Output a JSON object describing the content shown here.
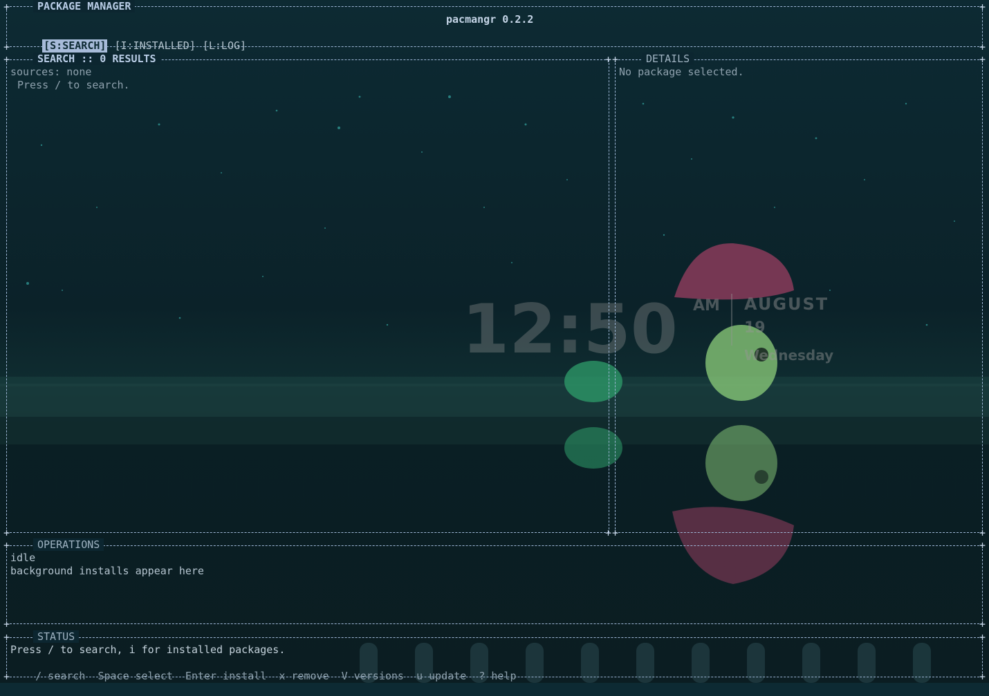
{
  "app": {
    "panel_title": "PACKAGE MANAGER",
    "name": "pacmangr 0.2.2"
  },
  "tabs": [
    {
      "label": "[S:SEARCH]",
      "active": true
    },
    {
      "label": "[I:INSTALLED]",
      "active": false
    },
    {
      "label": "[L:LOG]",
      "active": false
    }
  ],
  "search": {
    "title": "SEARCH :: 0 RESULTS",
    "sources": "sources: none",
    "hint": "Press / to search."
  },
  "details": {
    "title": "DETAILS",
    "empty": "No package selected."
  },
  "operations": {
    "title": "OPERATIONS",
    "state": "idle",
    "note": "background installs appear here"
  },
  "status": {
    "title": "STATUS",
    "message": "Press / to search, i for installed packages.",
    "keys": [
      {
        "label": "/ search"
      },
      {
        "label": "Space select"
      },
      {
        "label": "Enter install"
      },
      {
        "label": "x remove"
      },
      {
        "label": "V versions"
      },
      {
        "label": "u update"
      },
      {
        "label": "? help"
      }
    ]
  },
  "wallpaper": {
    "time": "12:50",
    "ampm": "AM",
    "month": "AUGUST",
    "day": "19",
    "weekday": "Wednesday"
  },
  "colors": {
    "border": "#9fb8d8",
    "active_tab_bg": "#a7bbd9",
    "text": "#b4c4cf",
    "background": "#0d2a33"
  }
}
